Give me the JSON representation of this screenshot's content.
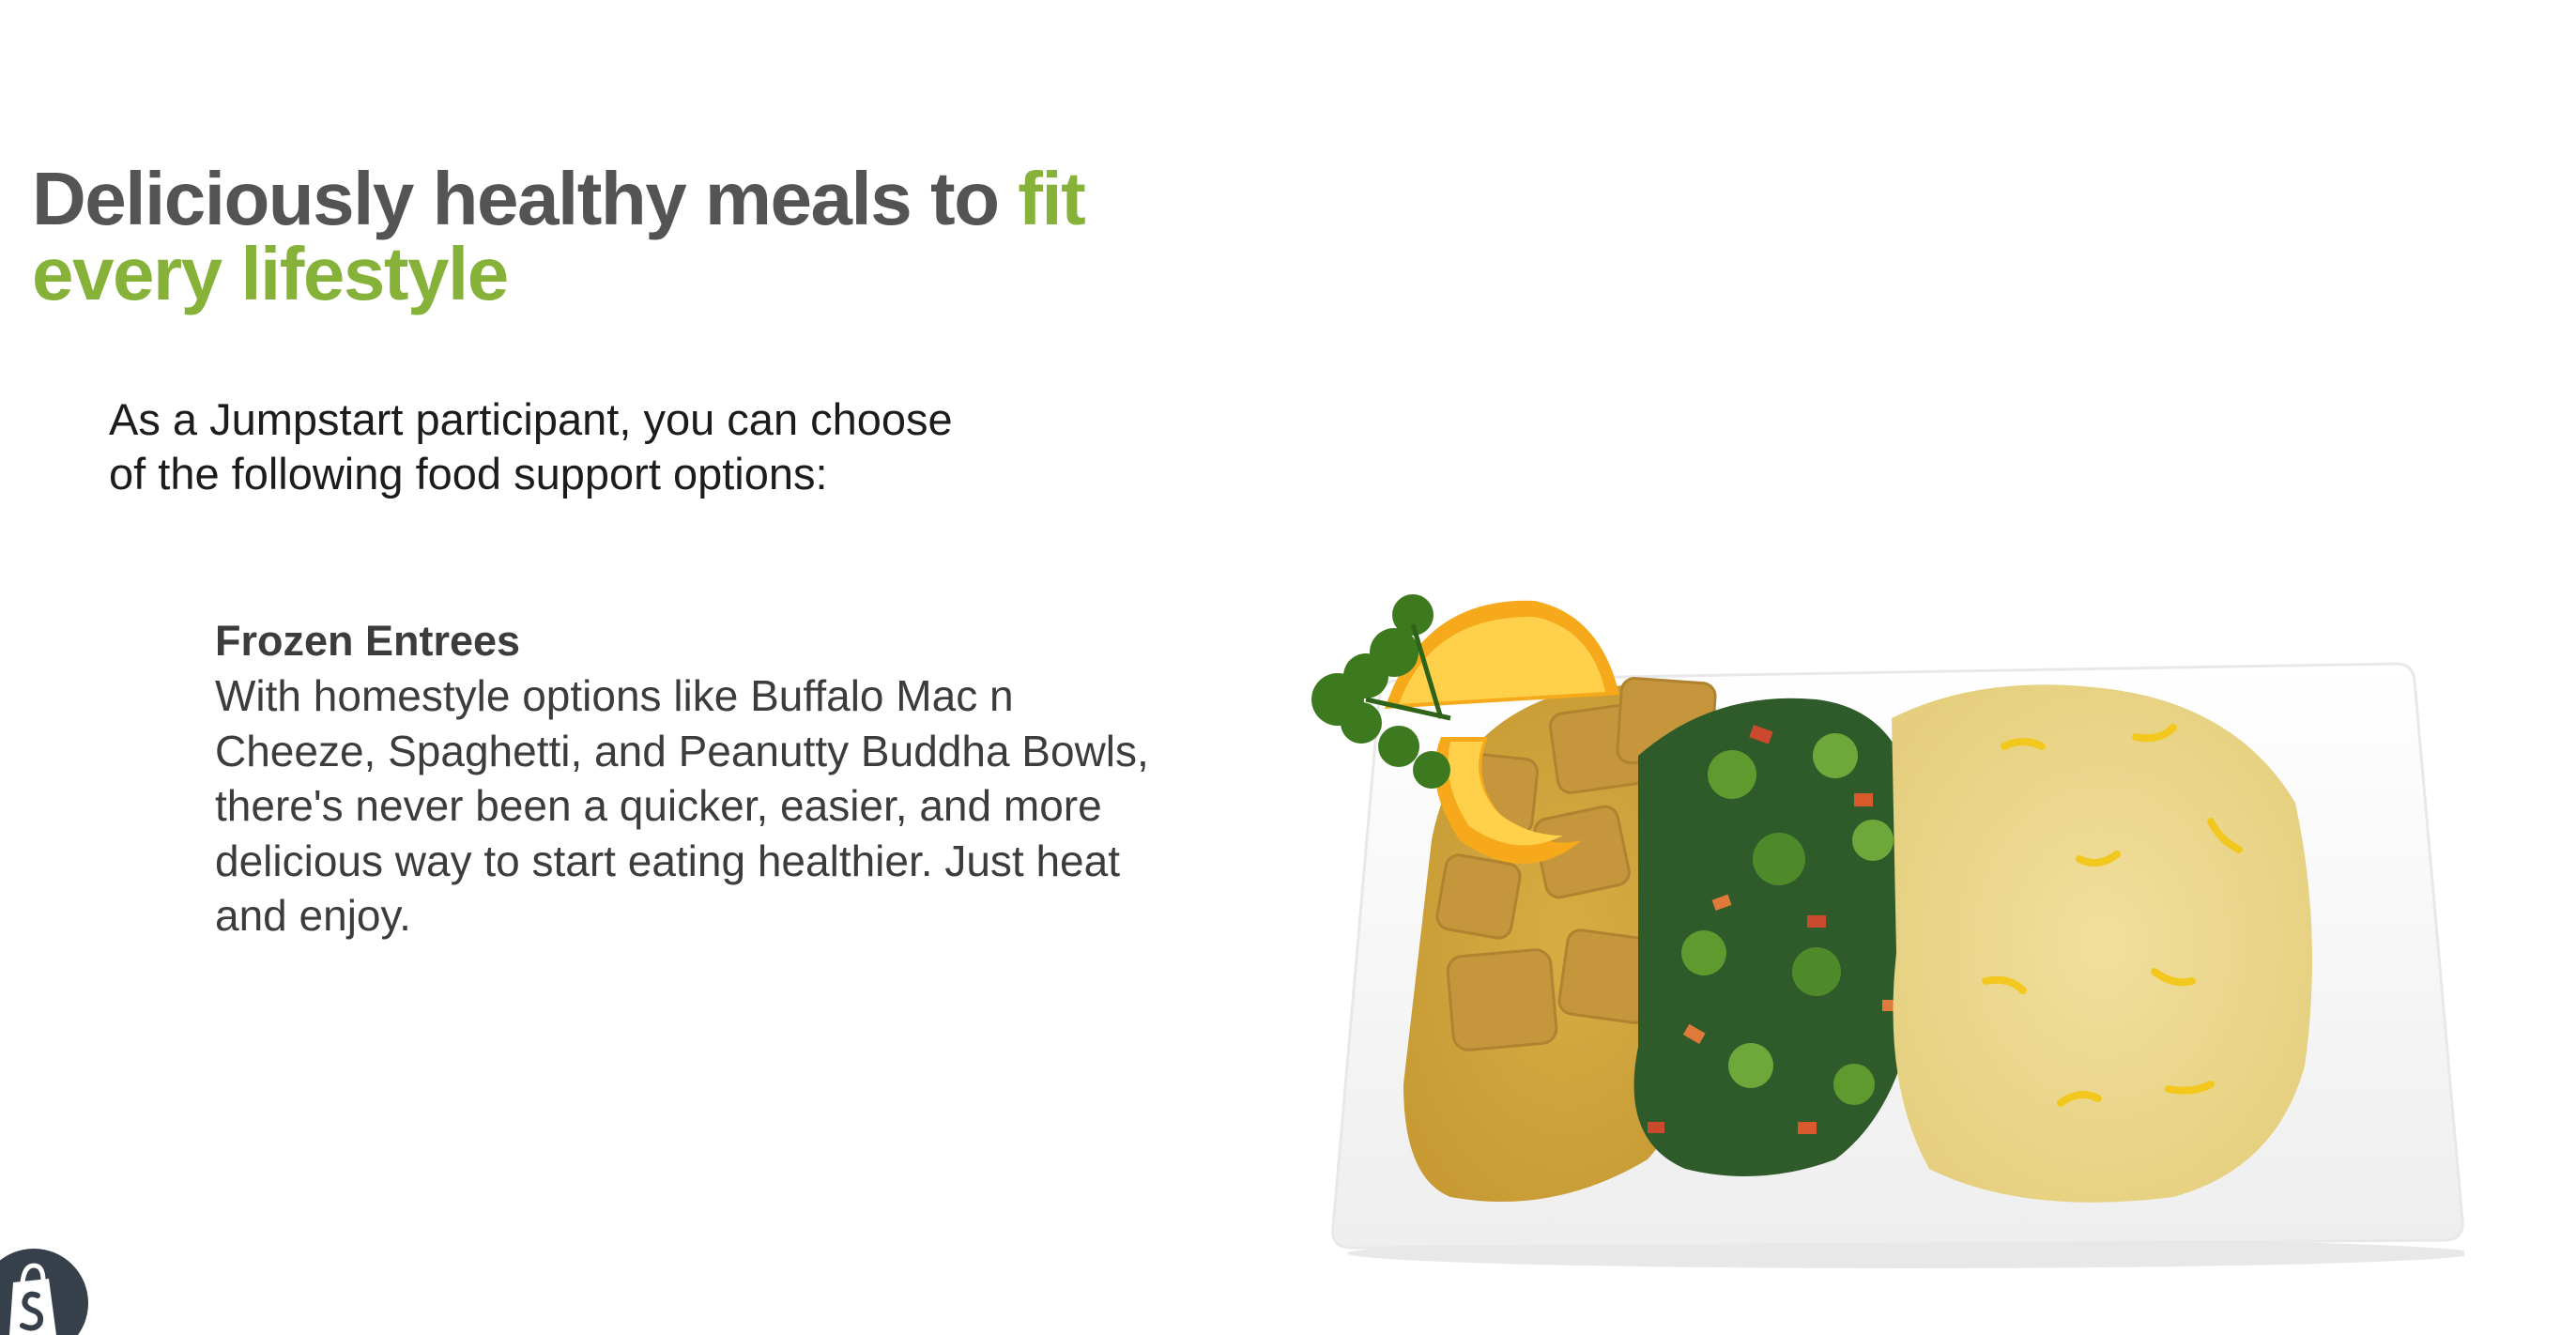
{
  "hero": {
    "headline_part1": "Deliciously healthy meals to ",
    "headline_part2": "fit every lifestyle",
    "intro_line1": "As a Jumpstart participant, you can choose",
    "intro_line2": "of the following food support options:"
  },
  "option": {
    "title": "Frozen Entrees",
    "description": "With homestyle options like Buffalo Mac n Cheeze, Spaghetti, and Peanutty Buddha Bowls, there's never been a quicker, easier, and more delicious way to start eating healthier. Just heat and enjoy."
  },
  "image": {
    "alt": "Plated meal with curry tofu, sautéed greens, and couscous"
  },
  "colors": {
    "headline": "#545454",
    "accent": "#86b23a",
    "body": "#3c3c3c",
    "badge": "#36404a"
  },
  "icons": {
    "badge": "shopify-bag-icon"
  }
}
